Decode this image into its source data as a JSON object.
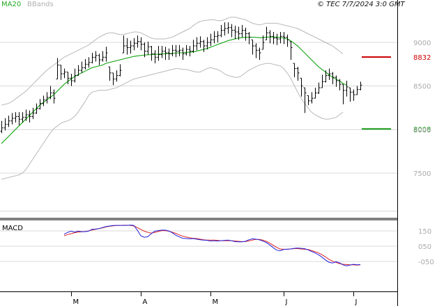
{
  "legend": {
    "ma_label": "MA20",
    "bb_label": "BBands"
  },
  "copyright": "© TEC 7/7/2024 3:0 GMT",
  "macd_label": "MACD",
  "colors": {
    "price": "#000000",
    "ma20": "#22aa22",
    "bbands": "#b8b8b8",
    "resistance": "#cc0000",
    "support": "#119911",
    "macd": "#2222dd",
    "signal": "#dd2222",
    "grid": "#d8d8d8"
  },
  "chart_data": [
    {
      "type": "ohlc",
      "title": "",
      "y_ticks": [
        "9000",
        "8500",
        "8000",
        "7500"
      ],
      "y_tick_values": [
        9000,
        8500,
        8000,
        7500
      ],
      "x_ticks": [
        "M",
        "A",
        "M",
        "J",
        "J"
      ],
      "x_tick_index": [
        20,
        40,
        60,
        81,
        101
      ],
      "levels": [
        {
          "name": "resistance",
          "label": "8832",
          "value": 8832
        },
        {
          "name": "support",
          "label": "8008",
          "value": 8008
        }
      ],
      "close": [
        8020,
        8060,
        8100,
        8130,
        8150,
        8120,
        8140,
        8170,
        8150,
        8190,
        8240,
        8300,
        8340,
        8370,
        8420,
        8360,
        8740,
        8640,
        8660,
        8590,
        8560,
        8620,
        8680,
        8710,
        8750,
        8770,
        8830,
        8850,
        8800,
        8830,
        8880,
        8650,
        8580,
        8620,
        8680,
        8960,
        8940,
        8960,
        8990,
        9010,
        8980,
        8900,
        8950,
        8870,
        8830,
        8860,
        8900,
        8880,
        8870,
        8910,
        8900,
        8910,
        8870,
        8920,
        8900,
        8960,
        8990,
        9010,
        8960,
        9000,
        9030,
        9070,
        9080,
        9140,
        9160,
        9170,
        9140,
        9120,
        9100,
        9140,
        9100,
        9060,
        8960,
        8910,
        8880,
        9000,
        9110,
        9070,
        9050,
        9040,
        9070,
        9060,
        9030,
        8940,
        8700,
        8650,
        8500,
        8420,
        8330,
        8360,
        8420,
        8480,
        8550,
        8620,
        8640,
        8600,
        8560,
        8520,
        8450,
        8490,
        8430,
        8400,
        8460,
        8510
      ],
      "range_hi": [
        8100,
        8130,
        8160,
        8190,
        8200,
        8200,
        8200,
        8230,
        8220,
        8250,
        8300,
        8350,
        8390,
        8430,
        8500,
        8460,
        8820,
        8740,
        8700,
        8660,
        8640,
        8700,
        8740,
        8780,
        8810,
        8830,
        8880,
        8900,
        8870,
        8900,
        8950,
        8720,
        8650,
        8680,
        8750,
        9080,
        9050,
        9020,
        9050,
        9080,
        9060,
        9000,
        9010,
        8960,
        8910,
        8960,
        8960,
        8950,
        8930,
        8970,
        8970,
        8970,
        8940,
        8970,
        8960,
        9030,
        9060,
        9070,
        9030,
        9060,
        9100,
        9130,
        9130,
        9200,
        9230,
        9230,
        9210,
        9190,
        9180,
        9200,
        9170,
        9120,
        9030,
        8990,
        8940,
        9080,
        9180,
        9140,
        9120,
        9100,
        9120,
        9120,
        9090,
        9010,
        8760,
        8720,
        8590,
        8480,
        8390,
        8430,
        8480,
        8540,
        8630,
        8680,
        8700,
        8660,
        8620,
        8580,
        8520,
        8560,
        8480,
        8460,
        8500,
        8550
      ],
      "range_lo": [
        7960,
        7990,
        8030,
        8060,
        8080,
        8050,
        8080,
        8100,
        8080,
        8120,
        8180,
        8230,
        8270,
        8300,
        8350,
        8300,
        8580,
        8570,
        8590,
        8520,
        8500,
        8540,
        8620,
        8650,
        8690,
        8710,
        8760,
        8780,
        8740,
        8780,
        8780,
        8560,
        8510,
        8550,
        8610,
        8880,
        8860,
        8870,
        8910,
        8940,
        8910,
        8830,
        8860,
        8790,
        8760,
        8790,
        8820,
        8800,
        8800,
        8840,
        8830,
        8840,
        8800,
        8850,
        8840,
        8880,
        8910,
        8940,
        8890,
        8920,
        8960,
        8990,
        9000,
        9060,
        9080,
        9100,
        9060,
        9040,
        9030,
        9060,
        9020,
        8980,
        8860,
        8820,
        8800,
        8920,
        9030,
        8990,
        8980,
        8970,
        8990,
        8980,
        8950,
        8800,
        8600,
        8560,
        8380,
        8190,
        8280,
        8300,
        8360,
        8410,
        8480,
        8540,
        8570,
        8520,
        8490,
        8450,
        8290,
        8380,
        8320,
        8330,
        8400,
        8450
      ],
      "ma20": [
        7840,
        7880,
        7920,
        7960,
        8000,
        8040,
        8080,
        8120,
        8160,
        8200,
        8240,
        8280,
        8310,
        8340,
        8370,
        8400,
        8440,
        8480,
        8520,
        8550,
        8580,
        8610,
        8630,
        8650,
        8670,
        8690,
        8710,
        8720,
        8730,
        8740,
        8760,
        8770,
        8780,
        8790,
        8800,
        8810,
        8820,
        8830,
        8840,
        8845,
        8850,
        8855,
        8858,
        8860,
        8862,
        8865,
        8868,
        8870,
        8872,
        8875,
        8878,
        8880,
        8882,
        8885,
        8888,
        8892,
        8900,
        8910,
        8920,
        8930,
        8945,
        8960,
        8975,
        8990,
        9005,
        9020,
        9030,
        9040,
        9050,
        9055,
        9060,
        9060,
        9060,
        9058,
        9055,
        9055,
        9060,
        9062,
        9062,
        9060,
        9058,
        9050,
        9040,
        9020,
        8990,
        8960,
        8920,
        8880,
        8840,
        8800,
        8760,
        8720,
        8690,
        8660,
        8630,
        8600,
        8580,
        8560,
        8530,
        8510
      ],
      "bb_upper": [
        8280,
        8290,
        8300,
        8320,
        8350,
        8380,
        8410,
        8440,
        8480,
        8520,
        8560,
        8600,
        8640,
        8680,
        8710,
        8740,
        8770,
        8800,
        8830,
        8850,
        8870,
        8890,
        8910,
        8930,
        8950,
        8970,
        9000,
        9030,
        9060,
        9080,
        9100,
        9110,
        9110,
        9100,
        9090,
        9090,
        9100,
        9110,
        9120,
        9120,
        9110,
        9090,
        9070,
        9050,
        9040,
        9040,
        9040,
        9040,
        9050,
        9060,
        9080,
        9100,
        9120,
        9140,
        9160,
        9190,
        9220,
        9240,
        9250,
        9255,
        9260,
        9260,
        9250,
        9250,
        9260,
        9280,
        9290,
        9290,
        9280,
        9270,
        9260,
        9240,
        9220,
        9210,
        9200,
        9210,
        9220,
        9220,
        9220,
        9220,
        9210,
        9200,
        9190,
        9180,
        9170,
        9160,
        9140,
        9120,
        9100,
        9080,
        9060,
        9040,
        9020,
        9000,
        8980,
        8960,
        8930,
        8900,
        8870
      ],
      "bb_lower": [
        7430,
        7440,
        7450,
        7460,
        7470,
        7480,
        7500,
        7540,
        7600,
        7660,
        7720,
        7780,
        7840,
        7900,
        7960,
        8010,
        8040,
        8070,
        8090,
        8100,
        8120,
        8150,
        8200,
        8260,
        8320,
        8390,
        8430,
        8440,
        8450,
        8450,
        8450,
        8460,
        8470,
        8480,
        8500,
        8520,
        8540,
        8560,
        8580,
        8590,
        8600,
        8610,
        8620,
        8630,
        8640,
        8650,
        8660,
        8670,
        8680,
        8690,
        8700,
        8700,
        8690,
        8690,
        8680,
        8670,
        8660,
        8660,
        8680,
        8700,
        8710,
        8700,
        8690,
        8670,
        8640,
        8620,
        8610,
        8600,
        8600,
        8620,
        8650,
        8680,
        8700,
        8720,
        8740,
        8750,
        8760,
        8760,
        8750,
        8740,
        8730,
        8700,
        8650,
        8590,
        8510,
        8430,
        8360,
        8300,
        8250,
        8200,
        8170,
        8150,
        8130,
        8120,
        8120,
        8130,
        8140,
        8170,
        8200
      ]
    },
    {
      "type": "line",
      "title": "",
      "y_ticks": [
        "150",
        "050",
        "-050"
      ],
      "y_tick_values": [
        150,
        50,
        -50
      ],
      "macd": [
        128,
        140,
        148,
        142,
        148,
        145,
        145,
        148,
        160,
        162,
        165,
        172,
        178,
        182,
        185,
        186,
        186,
        186,
        186,
        188,
        186,
        155,
        118,
        108,
        112,
        132,
        148,
        152,
        155,
        155,
        150,
        138,
        122,
        112,
        102,
        100,
        98,
        100,
        96,
        92,
        90,
        88,
        84,
        86,
        84,
        86,
        88,
        90,
        86,
        80,
        78,
        78,
        82,
        92,
        98,
        96,
        92,
        84,
        74,
        58,
        40,
        24,
        20,
        28,
        30,
        32,
        36,
        38,
        36,
        34,
        26,
        16,
        6,
        -6,
        -22,
        -40,
        -55,
        -60,
        -52,
        -58,
        -72,
        -78,
        -74,
        -68,
        -72,
        -70
      ],
      "signal": [
        118,
        126,
        132,
        138,
        142,
        144,
        146,
        150,
        156,
        160,
        165,
        170,
        176,
        180,
        183,
        185,
        186,
        187,
        187,
        186,
        182,
        172,
        160,
        148,
        140,
        136,
        140,
        146,
        152,
        152,
        148,
        142,
        134,
        124,
        116,
        110,
        105,
        102,
        100,
        96,
        92,
        90,
        90,
        90,
        88,
        86,
        86,
        86,
        86,
        84,
        82,
        80,
        80,
        84,
        90,
        94,
        94,
        90,
        82,
        70,
        56,
        42,
        32,
        30,
        30,
        32,
        34,
        34,
        32,
        30,
        28,
        22,
        14,
        6,
        -6,
        -20,
        -36,
        -48,
        -56,
        -64,
        -68,
        -70,
        -72,
        -72,
        -74,
        -72
      ]
    }
  ]
}
